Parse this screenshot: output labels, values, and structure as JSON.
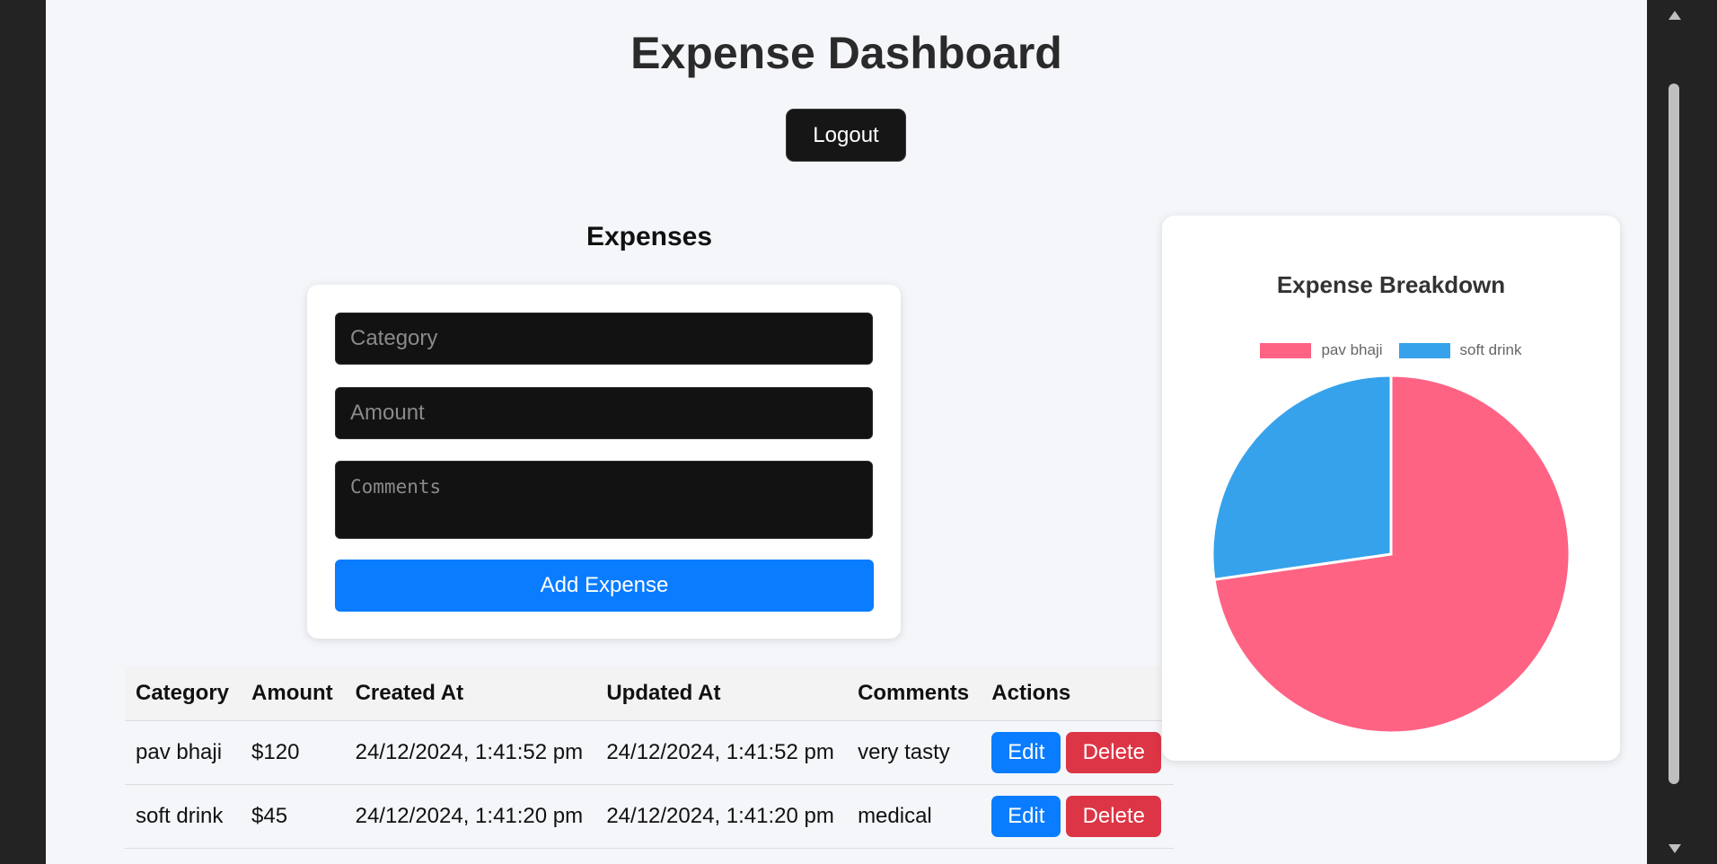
{
  "header": {
    "title": "Expense Dashboard",
    "logout_label": "Logout"
  },
  "expenses": {
    "section_title": "Expenses",
    "form": {
      "category_placeholder": "Category",
      "amount_placeholder": "Amount",
      "comments_placeholder": "Comments",
      "add_label": "Add Expense"
    },
    "table": {
      "headers": [
        "Category",
        "Amount",
        "Created At",
        "Updated At",
        "Comments",
        "Actions"
      ],
      "rows": [
        {
          "category": "pav bhaji",
          "amount": "$120",
          "created_at": "24/12/2024, 1:41:52 pm",
          "updated_at": "24/12/2024, 1:41:52 pm",
          "comments": "very tasty",
          "edit_label": "Edit",
          "delete_label": "Delete"
        },
        {
          "category": "soft drink",
          "amount": "$45",
          "created_at": "24/12/2024, 1:41:20 pm",
          "updated_at": "24/12/2024, 1:41:20 pm",
          "comments": "medical",
          "edit_label": "Edit",
          "delete_label": "Delete"
        }
      ]
    }
  },
  "chart_data": {
    "type": "pie",
    "title": "Expense Breakdown",
    "categories": [
      "pav bhaji",
      "soft drink"
    ],
    "values": [
      120,
      45
    ],
    "colors": [
      "#ff6384",
      "#36a2eb"
    ],
    "legend": "top"
  },
  "colors": {
    "primary": "#0a7cff",
    "danger": "#dc3545",
    "dark": "#161616",
    "page_bg": "#f4f6fa"
  }
}
